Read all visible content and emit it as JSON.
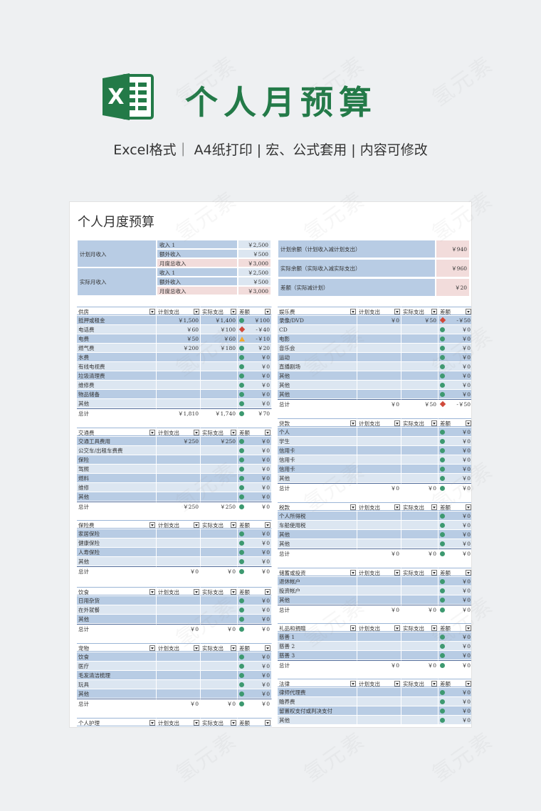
{
  "hero": {
    "logo_letter": "X",
    "title": "个人月预算",
    "subtitle": "Excel格式｜ A4纸打印 | 宏、公式套用 | 内容可修改"
  },
  "watermark": "氢元素",
  "colors": {
    "brand_green": "#237a48",
    "header_blue": "#b8cce4",
    "light_blue": "#dce6f1",
    "pink": "#f2dcdb"
  },
  "sheet": {
    "title": "个人月度预算",
    "income": {
      "planned_label": "计划月收入",
      "actual_label": "实际月收入",
      "planned_rows": [
        {
          "label": "收入 1",
          "value": "￥2,500"
        },
        {
          "label": "额外收入",
          "value": "￥500"
        },
        {
          "label": "月度总收入",
          "value": "￥3,000"
        }
      ],
      "actual_rows": [
        {
          "label": "收入 1",
          "value": "￥2,500"
        },
        {
          "label": "额外收入",
          "value": "￥500"
        },
        {
          "label": "月度总收入",
          "value": "￥3,000"
        }
      ]
    },
    "balance": [
      {
        "label": "计划余额（计划收入减计划支出）",
        "value": "￥940"
      },
      {
        "label": "实际余额（实际收入减实际支出）",
        "value": "￥960"
      },
      {
        "label": "差额（实际减计划）",
        "value": "￥20"
      }
    ],
    "col_headers": {
      "planned": "计划支出",
      "actual": "实际支出",
      "diff": "差额"
    },
    "left_blocks": [
      {
        "title": "供房",
        "rows": [
          {
            "name": "抵押或租金",
            "planned": "￥1,500",
            "actual": "￥1,400",
            "diff": "￥100",
            "ind": "g"
          },
          {
            "name": "电话费",
            "planned": "￥60",
            "actual": "￥100",
            "diff": "-￥40",
            "ind": "r"
          },
          {
            "name": "电费",
            "planned": "￥50",
            "actual": "￥60",
            "diff": "-￥10",
            "ind": "y"
          },
          {
            "name": "燃气费",
            "planned": "￥200",
            "actual": "￥180",
            "diff": "￥20",
            "ind": "g"
          },
          {
            "name": "水费",
            "planned": "",
            "actual": "",
            "diff": "￥0",
            "ind": "g"
          },
          {
            "name": "有线电视费",
            "planned": "",
            "actual": "",
            "diff": "￥0",
            "ind": "g"
          },
          {
            "name": "垃圾清理费",
            "planned": "",
            "actual": "",
            "diff": "￥0",
            "ind": "g"
          },
          {
            "name": "维修费",
            "planned": "",
            "actual": "",
            "diff": "￥0",
            "ind": "g"
          },
          {
            "name": "物品储备",
            "planned": "",
            "actual": "",
            "diff": "￥0",
            "ind": "g"
          },
          {
            "name": "其他",
            "planned": "",
            "actual": "",
            "diff": "￥0",
            "ind": "g"
          }
        ],
        "total": {
          "name": "总计",
          "planned": "￥1,810",
          "actual": "￥1,740",
          "diff": "￥70",
          "ind": "g"
        }
      },
      {
        "title": "交通费",
        "rows": [
          {
            "name": "交通工具费用",
            "planned": "￥250",
            "actual": "￥250",
            "diff": "￥0",
            "ind": "g"
          },
          {
            "name": "公交车/出租车费费",
            "planned": "",
            "actual": "",
            "diff": "￥0",
            "ind": "g"
          },
          {
            "name": "保险",
            "planned": "",
            "actual": "",
            "diff": "￥0",
            "ind": "g"
          },
          {
            "name": "驾照",
            "planned": "",
            "actual": "",
            "diff": "￥0",
            "ind": "g"
          },
          {
            "name": "燃料",
            "planned": "",
            "actual": "",
            "diff": "￥0",
            "ind": "g"
          },
          {
            "name": "维修",
            "planned": "",
            "actual": "",
            "diff": "￥0",
            "ind": "g"
          },
          {
            "name": "其他",
            "planned": "",
            "actual": "",
            "diff": "￥0",
            "ind": "g"
          }
        ],
        "total": {
          "name": "总计",
          "planned": "￥250",
          "actual": "￥250",
          "diff": "￥0",
          "ind": "g"
        }
      },
      {
        "title": "保险费",
        "rows": [
          {
            "name": "家居保险",
            "planned": "",
            "actual": "",
            "diff": "￥0",
            "ind": "g"
          },
          {
            "name": "健康保险",
            "planned": "",
            "actual": "",
            "diff": "￥0",
            "ind": "g"
          },
          {
            "name": "人寿保险",
            "planned": "",
            "actual": "",
            "diff": "￥0",
            "ind": "g"
          },
          {
            "name": "其他",
            "planned": "",
            "actual": "",
            "diff": "￥0",
            "ind": "g"
          }
        ],
        "total": {
          "name": "总计",
          "planned": "￥0",
          "actual": "￥0",
          "diff": "￥0",
          "ind": "g"
        }
      },
      {
        "title": "饮食",
        "rows": [
          {
            "name": "日用杂货",
            "planned": "",
            "actual": "",
            "diff": "￥0",
            "ind": "g"
          },
          {
            "name": "在外就餐",
            "planned": "",
            "actual": "",
            "diff": "￥0",
            "ind": "g"
          },
          {
            "name": "其他",
            "planned": "",
            "actual": "",
            "diff": "￥0",
            "ind": "g"
          }
        ],
        "total": {
          "name": "总计",
          "planned": "￥0",
          "actual": "￥0",
          "diff": "￥0",
          "ind": "g"
        }
      },
      {
        "title": "宠物",
        "rows": [
          {
            "name": "饮食",
            "planned": "",
            "actual": "",
            "diff": "￥0",
            "ind": "g"
          },
          {
            "name": "医疗",
            "planned": "",
            "actual": "",
            "diff": "￥0",
            "ind": "g"
          },
          {
            "name": "毛发清洁梳理",
            "planned": "",
            "actual": "",
            "diff": "￥0",
            "ind": "g"
          },
          {
            "name": "玩具",
            "planned": "",
            "actual": "",
            "diff": "￥0",
            "ind": "g"
          },
          {
            "name": "其他",
            "planned": "",
            "actual": "",
            "diff": "￥0",
            "ind": "g"
          }
        ],
        "total": {
          "name": "总计",
          "planned": "￥0",
          "actual": "￥0",
          "diff": "￥0",
          "ind": "g"
        }
      },
      {
        "title": "个人护理",
        "rows": [],
        "total": null
      }
    ],
    "right_blocks": [
      {
        "title": "娱乐费",
        "rows": [
          {
            "name": "录像/DVD",
            "planned": "￥0",
            "actual": "￥50",
            "diff": "-￥50",
            "ind": "r"
          },
          {
            "name": "CD",
            "planned": "",
            "actual": "",
            "diff": "￥0",
            "ind": "g"
          },
          {
            "name": "电影",
            "planned": "",
            "actual": "",
            "diff": "￥0",
            "ind": "g"
          },
          {
            "name": "音乐会",
            "planned": "",
            "actual": "",
            "diff": "￥0",
            "ind": "g"
          },
          {
            "name": "运动",
            "planned": "",
            "actual": "",
            "diff": "￥0",
            "ind": "g"
          },
          {
            "name": "直播剧场",
            "planned": "",
            "actual": "",
            "diff": "￥0",
            "ind": "g"
          },
          {
            "name": "其他",
            "planned": "",
            "actual": "",
            "diff": "￥0",
            "ind": "g"
          },
          {
            "name": "其他",
            "planned": "",
            "actual": "",
            "diff": "￥0",
            "ind": "g"
          },
          {
            "name": "其他",
            "planned": "",
            "actual": "",
            "diff": "￥0",
            "ind": "g"
          }
        ],
        "total": {
          "name": "总计",
          "planned": "￥0",
          "actual": "￥50",
          "diff": "-￥50",
          "ind": "r"
        }
      },
      {
        "title": "贷款",
        "rows": [
          {
            "name": "个人",
            "planned": "",
            "actual": "",
            "diff": "￥0",
            "ind": "g"
          },
          {
            "name": "学生",
            "planned": "",
            "actual": "",
            "diff": "￥0",
            "ind": "g"
          },
          {
            "name": "信用卡",
            "planned": "",
            "actual": "",
            "diff": "￥0",
            "ind": "g"
          },
          {
            "name": "信用卡",
            "planned": "",
            "actual": "",
            "diff": "￥0",
            "ind": "g"
          },
          {
            "name": "信用卡",
            "planned": "",
            "actual": "",
            "diff": "￥0",
            "ind": "g"
          },
          {
            "name": "其他",
            "planned": "",
            "actual": "",
            "diff": "￥0",
            "ind": "g"
          }
        ],
        "total": {
          "name": "总计",
          "planned": "￥0",
          "actual": "￥0",
          "diff": "￥0",
          "ind": "g"
        }
      },
      {
        "title": "税款",
        "rows": [
          {
            "name": "个人所得税",
            "planned": "",
            "actual": "",
            "diff": "￥0",
            "ind": "g"
          },
          {
            "name": "车船使用税",
            "planned": "",
            "actual": "",
            "diff": "￥0",
            "ind": "g"
          },
          {
            "name": "其他",
            "planned": "",
            "actual": "",
            "diff": "￥0",
            "ind": "g"
          },
          {
            "name": "其他",
            "planned": "",
            "actual": "",
            "diff": "￥0",
            "ind": "g"
          }
        ],
        "total": {
          "name": "总计",
          "planned": "￥0",
          "actual": "￥0",
          "diff": "￥0",
          "ind": "g"
        }
      },
      {
        "title": "储蓄或投资",
        "rows": [
          {
            "name": "退休帐户",
            "planned": "",
            "actual": "",
            "diff": "￥0",
            "ind": "g"
          },
          {
            "name": "投资帐户",
            "planned": "",
            "actual": "",
            "diff": "￥0",
            "ind": "g"
          },
          {
            "name": "其他",
            "planned": "",
            "actual": "",
            "diff": "￥0",
            "ind": "g"
          }
        ],
        "total": {
          "name": "总计",
          "planned": "￥0",
          "actual": "￥0",
          "diff": "￥0",
          "ind": "g"
        }
      },
      {
        "title": "礼品和捐赠",
        "rows": [
          {
            "name": "慈善 1",
            "planned": "",
            "actual": "",
            "diff": "￥0",
            "ind": "g"
          },
          {
            "name": "慈善 2",
            "planned": "",
            "actual": "",
            "diff": "￥0",
            "ind": "g"
          },
          {
            "name": "慈善 3",
            "planned": "",
            "actual": "",
            "diff": "￥0",
            "ind": "g"
          }
        ],
        "total": {
          "name": "总计",
          "planned": "￥0",
          "actual": "￥0",
          "diff": "￥0",
          "ind": "g"
        }
      },
      {
        "title": "法律",
        "rows": [
          {
            "name": "律师代理费",
            "planned": "",
            "actual": "",
            "diff": "￥0",
            "ind": "g"
          },
          {
            "name": "赡养费",
            "planned": "",
            "actual": "",
            "diff": "￥0",
            "ind": "g"
          },
          {
            "name": "留置权支付或判决支付",
            "planned": "",
            "actual": "",
            "diff": "￥0",
            "ind": "g"
          },
          {
            "name": "其他",
            "planned": "",
            "actual": "",
            "diff": "￥0",
            "ind": "g"
          }
        ],
        "total": null
      }
    ]
  }
}
